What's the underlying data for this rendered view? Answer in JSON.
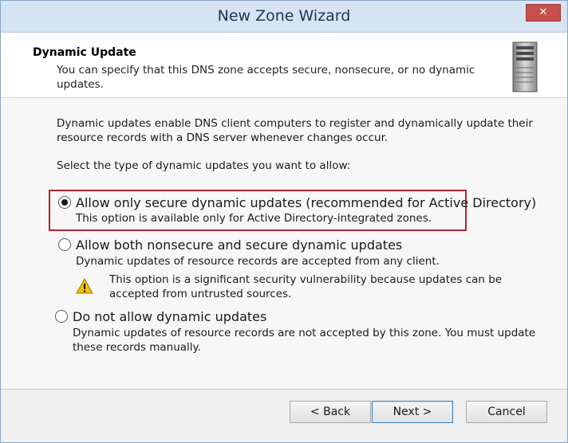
{
  "window": {
    "title": "New Zone Wizard",
    "close_label": "✕"
  },
  "header": {
    "title": "Dynamic Update",
    "description": "You can specify that this DNS zone accepts secure, nonsecure, or no dynamic updates."
  },
  "content": {
    "intro": "Dynamic updates enable DNS client computers to register and dynamically update their resource records with a DNS server whenever changes occur.",
    "prompt": "Select the type of dynamic updates you want to allow:",
    "options": [
      {
        "label": "Allow only secure dynamic updates (recommended for Active Directory)",
        "description": "This option is available only for Active Directory-integrated zones.",
        "selected": true
      },
      {
        "label": "Allow both nonsecure and secure dynamic updates",
        "description": "Dynamic updates of resource records are accepted from any client.",
        "warning": "This option is a significant security vulnerability because updates can be accepted from untrusted sources.",
        "selected": false
      },
      {
        "label": "Do not allow dynamic updates",
        "description": "Dynamic updates of resource records are not accepted by this zone. You must update these records manually.",
        "selected": false
      }
    ]
  },
  "buttons": {
    "back": "< Back",
    "next": "Next >",
    "cancel": "Cancel"
  },
  "icons": {
    "server": "server-icon",
    "warning": "warning-icon",
    "close": "close-icon"
  },
  "colors": {
    "highlight_border": "#b0262e",
    "titlebar": "#d6e3f2",
    "warning": "#f2c200"
  }
}
